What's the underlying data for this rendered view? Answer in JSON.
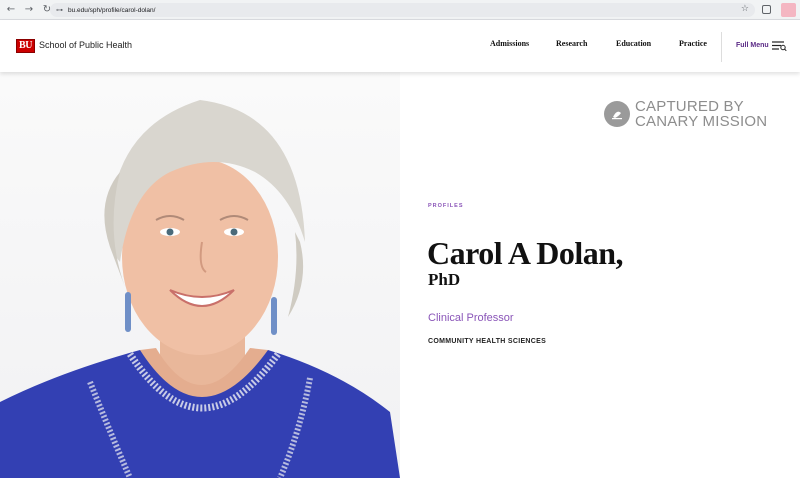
{
  "browser": {
    "back_icon": "←",
    "forward_icon": "→",
    "reload_icon": "↻",
    "tune_icon": "⊶",
    "url": "bu.edu/sph/profile/carol-dolan/",
    "star_icon": "☆",
    "profile_color": "#f4b6c2"
  },
  "header": {
    "logo_text": "BU",
    "school_name": "School of Public Health",
    "nav": {
      "admissions": "Admissions",
      "research": "Research",
      "education": "Education",
      "practice": "Practice"
    },
    "full_menu": "Full Menu",
    "accent_color": "#5b2a86"
  },
  "profile": {
    "kicker": "PROFILES",
    "name": "Carol A Dolan,",
    "credential": "PhD",
    "title": "Clinical Professor",
    "department": "COMMUNITY HEALTH SCIENCES",
    "accent_color": "#8a55b8"
  },
  "watermark": {
    "line1": "CAPTURED BY",
    "line2": "CANARY MISSION"
  }
}
